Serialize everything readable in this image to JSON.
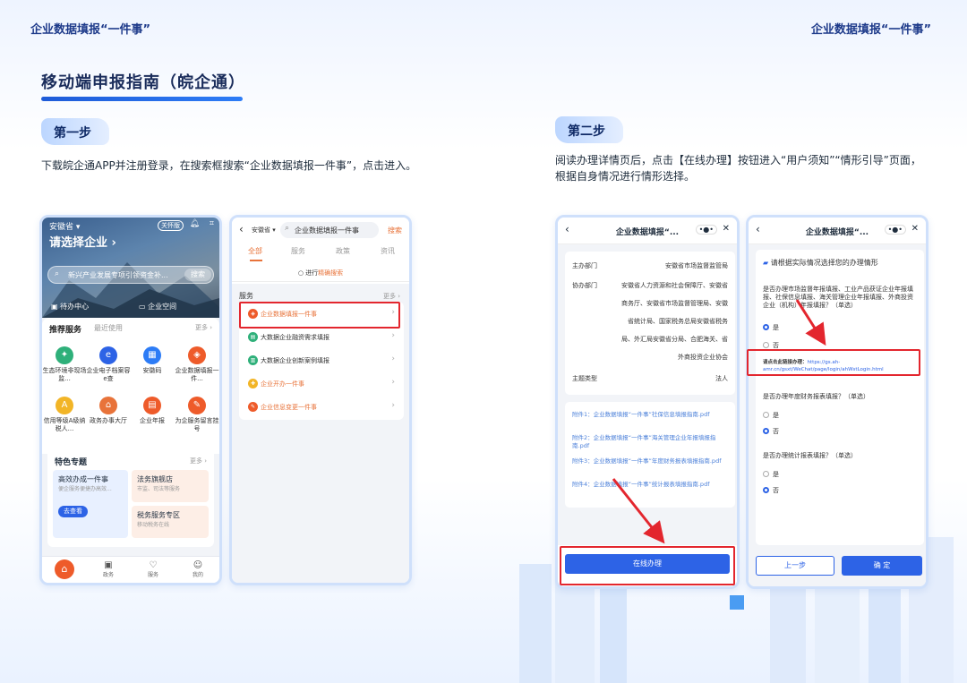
{
  "header": {
    "left": "企业数据填报“一件事”",
    "right": "企业数据填报“一件事”"
  },
  "title": "移动端申报指南（皖企通）",
  "step1": {
    "label": "第一步",
    "desc": "下载皖企通APP并注册登录，在搜索框搜索“企业数据填报一件事”，点击进入。",
    "phone1": {
      "location": "安徽省 ▾",
      "vip": "关怀版",
      "choose": "请选择企业 ›",
      "search_placeholder": "新兴产业发展专项引领资金补...",
      "search_btn": "搜索",
      "quick": [
        "待办中心",
        "企业空间"
      ],
      "tabs": [
        "推荐服务",
        "最近使用",
        "更多 ›"
      ],
      "grid": [
        {
          "label": "生态环境非现场监...",
          "color": "#2fb07a",
          "glyph": "✦"
        },
        {
          "label": "企业电子档案容e查",
          "color": "#2d63e6",
          "glyph": "e"
        },
        {
          "label": "安徽码",
          "color": "#2d7cf6",
          "glyph": "▦"
        },
        {
          "label": "企业数据填报一件...",
          "color": "#ee5b2a",
          "glyph": "◈"
        },
        {
          "label": "信用等级A级纳税人...",
          "color": "#f2b527",
          "glyph": "A"
        },
        {
          "label": "政务办事大厅",
          "color": "#e8733a",
          "glyph": "⌂"
        },
        {
          "label": "企业年报",
          "color": "#ee5b2a",
          "glyph": "▤"
        },
        {
          "label": "为企服务留言挂号",
          "color": "#ee5b2a",
          "glyph": "✎"
        }
      ],
      "special": {
        "title": "特色专题",
        "more": "更多 ›",
        "items": [
          {
            "title": "高效办成一件事",
            "sub": "便企服务便捷办高效..."
          },
          {
            "title": "法务旗舰店",
            "sub": "市监、司法等服务"
          },
          {
            "title": "税务服务专区",
            "sub": "移动税务在线"
          }
        ],
        "go": "去查看"
      },
      "nav": [
        "首页",
        "政务",
        "服务",
        "我的"
      ]
    },
    "phone2": {
      "location": "安徽省 ▾",
      "query": "企业数据填报一件事",
      "search_btn": "搜索",
      "tabs": [
        "全部",
        "服务",
        "政策",
        "资讯"
      ],
      "exact_prefix": "进行",
      "exact_hl": "精确搜索",
      "section": "服务",
      "more": "更多 ›",
      "items": [
        {
          "text": "企业数据填报一件事",
          "color": "#ee5b2a",
          "glyph": "◈"
        },
        {
          "text_a": "大数据企业融资需求填报",
          "color": "#2fb07a",
          "glyph": "▤"
        },
        {
          "text_a": "大数据企业创新案例填报",
          "color": "#2fb07a",
          "glyph": "▥"
        },
        {
          "text": "企业开办一件事",
          "color": "#f2b527",
          "glyph": "✚"
        },
        {
          "text": "企业信息变更一件事",
          "color": "#ee5b2a",
          "glyph": "✎"
        }
      ]
    }
  },
  "step2": {
    "label": "第二步",
    "desc": "阅读办理详情页后，点击【在线办理】按钮进入“用户须知”“情形引导”页面，根据自身情况进行情形选择。",
    "phone3": {
      "title": "企业数据填报“...",
      "dots": "•●•",
      "close": "✕",
      "rows": [
        {
          "k": "主办部门",
          "v": "安徽省市场监督监管局"
        },
        {
          "k": "协办部门",
          "v": "安徽省人力资源和社会保障厅、安徽省"
        },
        {
          "v": "商务厅、安徽省市场监督管理局、安徽"
        },
        {
          "v": "省统计局、国家税务总局安徽省税务"
        },
        {
          "v": "局、外汇局安徽省分局、合肥海关、省"
        },
        {
          "v": "外商投资企业协会"
        },
        {
          "k": "主题类型",
          "v": "法人"
        }
      ],
      "attachments": [
        "附件1：企业数据填报“一件事”社保信息填报指南.pdf",
        "附件2：企业数据填报“一件事”海关管理企业年报填报指南.pdf",
        "附件3：企业数据填报“一件事”年度财务报表填报指南.pdf",
        "附件4：企业数据填报“一件事”统计报表填报指南.pdf"
      ],
      "online_btn": "在线办理"
    },
    "phone4": {
      "title": "企业数据填报“...",
      "dots": "•●•",
      "close": "✕",
      "prompt": "请根据实际情况选择您的办理情形",
      "q1": "是否办理市场监督年报填报、工业产品获证企业年报填报、社保信息填报、海关管理企业年报填报、外商投资企业（机构）年报填报？（单选）",
      "q1_opts": [
        "是",
        "否"
      ],
      "link_label": "请点击此链接办理：",
      "link_url": "https://gs.ah-amr.cn/gsxt/WeChat/page/login/ahWstLogin.html",
      "q2": "是否办理年度财务报表填报？（单选）",
      "q2_opts": [
        "是",
        "否"
      ],
      "q3": "是否办理统计报表填报？（单选）",
      "q3_opts": [
        "是",
        "否"
      ],
      "prev": "上一步",
      "ok": "确 定"
    }
  },
  "colors": {
    "accent": "#2d63e6",
    "highlight": "#e3262e",
    "orange": "#e8733a"
  }
}
